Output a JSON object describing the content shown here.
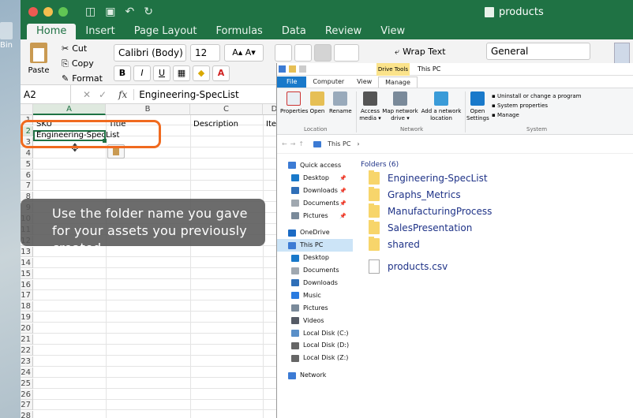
{
  "desktop": {
    "label": "Bin"
  },
  "excel": {
    "window_title": "products",
    "quick_access": [
      "sidebar",
      "save",
      "undo",
      "redo"
    ],
    "tabs": [
      "Home",
      "Insert",
      "Page Layout",
      "Formulas",
      "Data",
      "Review",
      "View"
    ],
    "active_tab": "Home",
    "ribbon": {
      "paste": "Paste",
      "cut": "Cut",
      "copy": "Copy",
      "format": "Format",
      "font_name": "Calibri (Body)",
      "font_size": "12",
      "grow_shrink": "A▴ A▾",
      "bold": "B",
      "italic": "I",
      "underline": "U",
      "wrap_text": "Wrap Text",
      "number_format": "General"
    },
    "formula_bar": {
      "name_box": "A2",
      "fx": "fx",
      "value": "Engineering-SpecList"
    },
    "columns": [
      "A",
      "B",
      "C",
      "D"
    ],
    "rows": [
      "1",
      "2",
      "3",
      "4",
      "5",
      "6",
      "7",
      "8",
      "9",
      "10",
      "11",
      "12",
      "13",
      "14",
      "15",
      "16",
      "17",
      "18",
      "19",
      "20",
      "21",
      "22",
      "23",
      "24",
      "25",
      "26",
      "27",
      "28"
    ],
    "cells": {
      "A1": "SKU",
      "B1": "Title",
      "C1": "Description",
      "D1": "Iten",
      "A2": "Engineering-SpecList"
    }
  },
  "callout": {
    "text": "Use the folder name you gave for your assets you previously created."
  },
  "explorer": {
    "drive_tools": "Drive Tools",
    "title": "This PC",
    "tabs": [
      "File",
      "Computer",
      "View",
      "Manage"
    ],
    "ribbon": {
      "properties": "Properties",
      "open": "Open",
      "rename": "Rename",
      "access_media": "Access media ▾",
      "map_drive": "Map network drive ▾",
      "add_location": "Add a network location",
      "open_settings": "Open Settings",
      "uninstall": "Uninstall or change a program",
      "sys_props": "System properties",
      "manage": "Manage",
      "group_location": "Location",
      "group_network": "Network",
      "group_system": "System"
    },
    "address": "This PC",
    "nav": [
      {
        "label": "Quick access",
        "pin": false,
        "color": "#3c7bd4"
      },
      {
        "label": "Desktop",
        "pin": true,
        "color": "#1979ca"
      },
      {
        "label": "Downloads",
        "pin": true,
        "color": "#2f6fb8"
      },
      {
        "label": "Documents",
        "pin": true,
        "color": "#a0a8b0"
      },
      {
        "label": "Pictures",
        "pin": true,
        "color": "#7a8a9a"
      },
      {
        "label": "OneDrive",
        "pin": false,
        "color": "#1a6ac4"
      },
      {
        "label": "This PC",
        "pin": false,
        "color": "#3c7bd4"
      },
      {
        "label": "Desktop",
        "pin": false,
        "color": "#1979ca"
      },
      {
        "label": "Documents",
        "pin": false,
        "color": "#a0a8b0"
      },
      {
        "label": "Downloads",
        "pin": false,
        "color": "#2f6fb8"
      },
      {
        "label": "Music",
        "pin": false,
        "color": "#2a7be0"
      },
      {
        "label": "Pictures",
        "pin": false,
        "color": "#7a8a9a"
      },
      {
        "label": "Videos",
        "pin": false,
        "color": "#555b66"
      },
      {
        "label": "Local Disk (C:)",
        "pin": false,
        "color": "#5a8fc8"
      },
      {
        "label": "Local Disk (D:)",
        "pin": false,
        "color": "#666"
      },
      {
        "label": "Local Disk (Z:)",
        "pin": false,
        "color": "#666"
      },
      {
        "label": "Network",
        "pin": false,
        "color": "#3c7bd4"
      }
    ],
    "folders_header": "Folders (6)",
    "folders": [
      "Engineering-SpecList",
      "Graphs_Metrics",
      "ManufacturingProcess",
      "SalesPresentation",
      "shared"
    ],
    "files": [
      "products.csv"
    ]
  },
  "colors": {
    "excel_green": "#1f7244",
    "highlight": "#f06a1f",
    "explorer_blue": "#1979ca"
  }
}
